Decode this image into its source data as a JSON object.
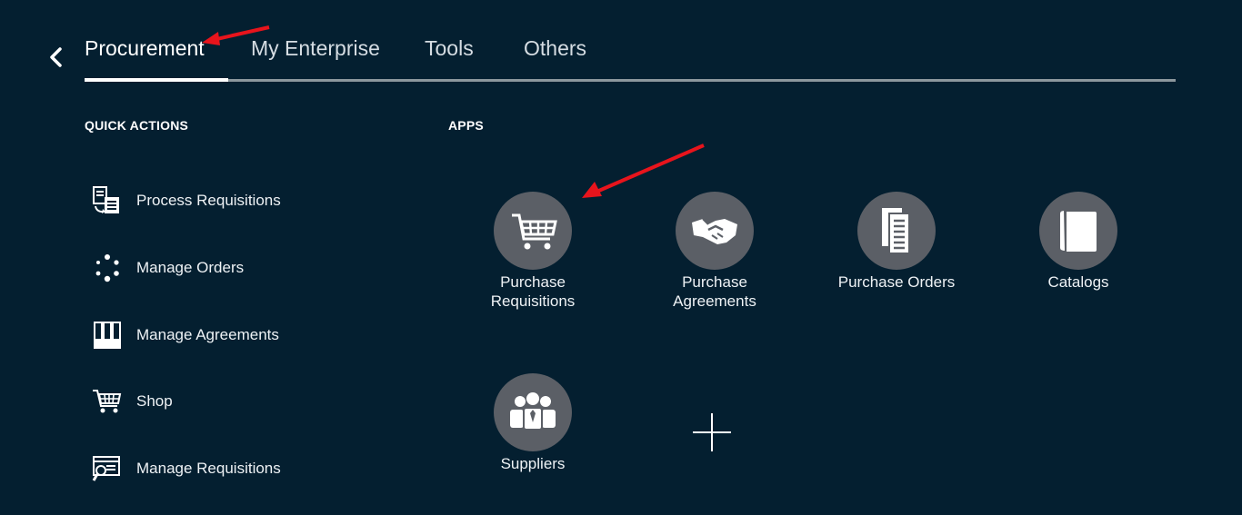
{
  "nav": {
    "tabs": [
      {
        "label": "Procurement",
        "active": true
      },
      {
        "label": "My Enterprise",
        "active": false
      },
      {
        "label": "Tools",
        "active": false
      },
      {
        "label": "Others",
        "active": false
      }
    ]
  },
  "quick_actions": {
    "title": "QUICK ACTIONS",
    "items": [
      {
        "label": "Process Requisitions",
        "icon": "process-requisitions-icon"
      },
      {
        "label": "Manage Orders",
        "icon": "manage-orders-icon"
      },
      {
        "label": "Manage Agreements",
        "icon": "manage-agreements-icon"
      },
      {
        "label": "Shop",
        "icon": "shopping-cart-icon"
      },
      {
        "label": "Manage Requisitions",
        "icon": "manage-requisitions-icon"
      }
    ]
  },
  "apps": {
    "title": "APPS",
    "items": [
      {
        "label": "Purchase Requisitions",
        "icon": "shopping-cart-icon"
      },
      {
        "label": "Purchase Agreements",
        "icon": "handshake-icon"
      },
      {
        "label": "Purchase Orders",
        "icon": "documents-icon"
      },
      {
        "label": "Catalogs",
        "icon": "catalog-book-icon"
      },
      {
        "label": "Suppliers",
        "icon": "people-group-icon"
      }
    ]
  },
  "colors": {
    "background": "#041f30",
    "tile_circle": "#5b5f66",
    "annotation_arrow": "#e8141c",
    "tab_track": "#8c979d"
  }
}
